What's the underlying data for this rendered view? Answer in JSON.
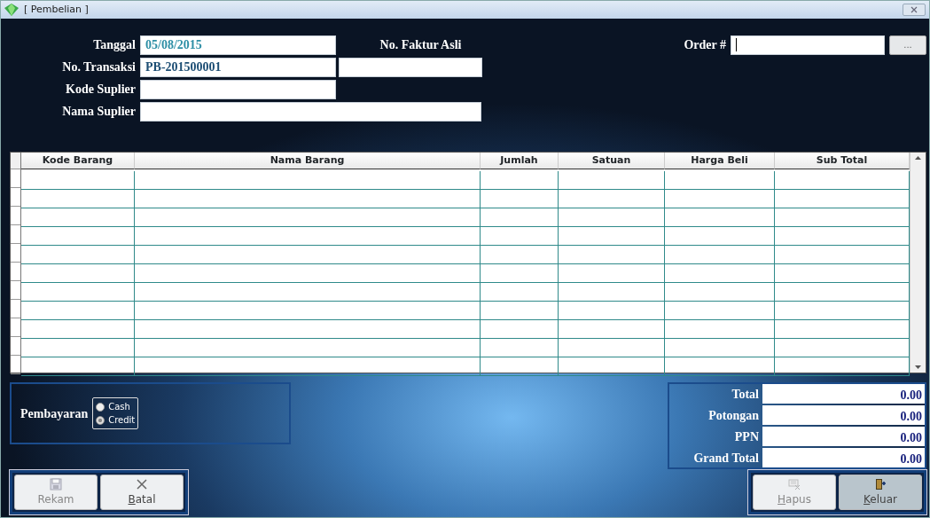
{
  "window": {
    "title": "[ Pembelian ]"
  },
  "form": {
    "fields": [
      {
        "label": "Tanggal",
        "value": "05/08/2015",
        "kind": "date"
      },
      {
        "label": "No. Transaksi",
        "value": "PB-201500001",
        "kind": "code"
      },
      {
        "label": "Kode Suplier",
        "kind": "short"
      },
      {
        "label": "Nama Suplier",
        "kind": "long"
      }
    ],
    "faktur": {
      "label": "No. Faktur Asli"
    },
    "order": {
      "label": "Order #",
      "focused": true,
      "button": "..."
    }
  },
  "table": {
    "columns": [
      "Kode Barang",
      "Nama Barang",
      "Jumlah",
      "Satuan",
      "Harga Beli",
      "Sub Total"
    ]
  },
  "payment": {
    "label": "Pembayaran",
    "options": [
      {
        "label": "Cash",
        "selected": false
      },
      {
        "label": "Credit",
        "selected": true
      }
    ]
  },
  "totals": [
    {
      "label": "Total",
      "value": "0.00"
    },
    {
      "label": "Potongan",
      "value": "0.00"
    },
    {
      "label": "PPN",
      "value": "0.00"
    },
    {
      "label": "Grand Total",
      "value": "0.00"
    }
  ],
  "buttons_left": [
    {
      "label": "Rekam",
      "kind": "floppy",
      "disabled": true,
      "underline_first": false
    },
    {
      "label": "Batal",
      "kind": "cross",
      "disabled": false,
      "underline_first": true
    }
  ],
  "buttons_right": [
    {
      "label": "Hapus",
      "kind": "erase",
      "disabled": true,
      "underline_first": true
    },
    {
      "label": "Keluar",
      "kind": "door",
      "disabled": false,
      "underline_first": true
    }
  ]
}
